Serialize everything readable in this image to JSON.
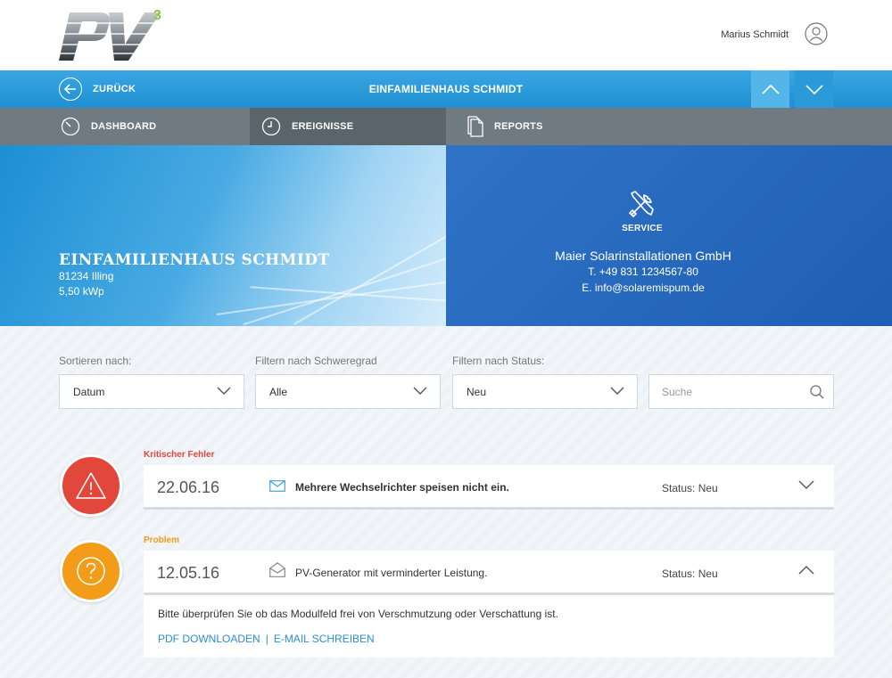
{
  "header": {
    "logo_text": "PV",
    "logo_superscript": "3",
    "user_name": "Marius Schmidt",
    "brand_color": "#8cc63f"
  },
  "navbar": {
    "back_label": "ZURÜCK",
    "title": "EINFAMILIENHAUS SCHMIDT",
    "accent": "#1f8fd3"
  },
  "tabs": [
    {
      "label": "DASHBOARD",
      "icon": "gauge-icon"
    },
    {
      "label": "EREIGNISSE",
      "icon": "clock-icon",
      "active": true
    },
    {
      "label": "REPORTS",
      "icon": "documents-icon"
    }
  ],
  "hero": {
    "title": "EINFAMILIENHAUS SCHMIDT",
    "address": "81234 Illing",
    "power": "5,50 kWp"
  },
  "service": {
    "label": "SERVICE",
    "icon": "tools-icon",
    "company": "Maier Solarinstallationen GmbH",
    "phone": "T. +49 831 1234567-80",
    "email": "E. info@solaremispum.de"
  },
  "filters": {
    "sort_label": "Sortieren nach:",
    "sort_value": "Datum",
    "severity_label": "Filtern nach Schweregrad",
    "severity_value": "Alle",
    "status_label": "Filtern nach Status:",
    "status_value": "Neu",
    "search_placeholder": "Suche"
  },
  "events": [
    {
      "severity": "Kritischer Fehler",
      "severity_color": "#e2473c",
      "icon": "warning-icon",
      "date": "22.06.16",
      "mail_icon": "envelope-closed-icon",
      "description": "Mehrere Wechselrichter speisen nicht ein.",
      "status": "Status: Neu",
      "expanded": false
    },
    {
      "severity": "Problem",
      "severity_color": "#f39c1a",
      "icon": "question-icon",
      "date": "12.05.16",
      "mail_icon": "envelope-open-icon",
      "description": "PV-Generator mit verminderter Leistung.",
      "status": "Status: Neu",
      "expanded": true,
      "detail_text": "Bitte überprüfen Sie ob das Modulfeld frei von Verschmutzung oder Verschattung ist.",
      "link_pdf": "PDF DOWNLOADEN",
      "link_separator": "|",
      "link_mail": "E-MAIL SCHREIBEN"
    }
  ]
}
